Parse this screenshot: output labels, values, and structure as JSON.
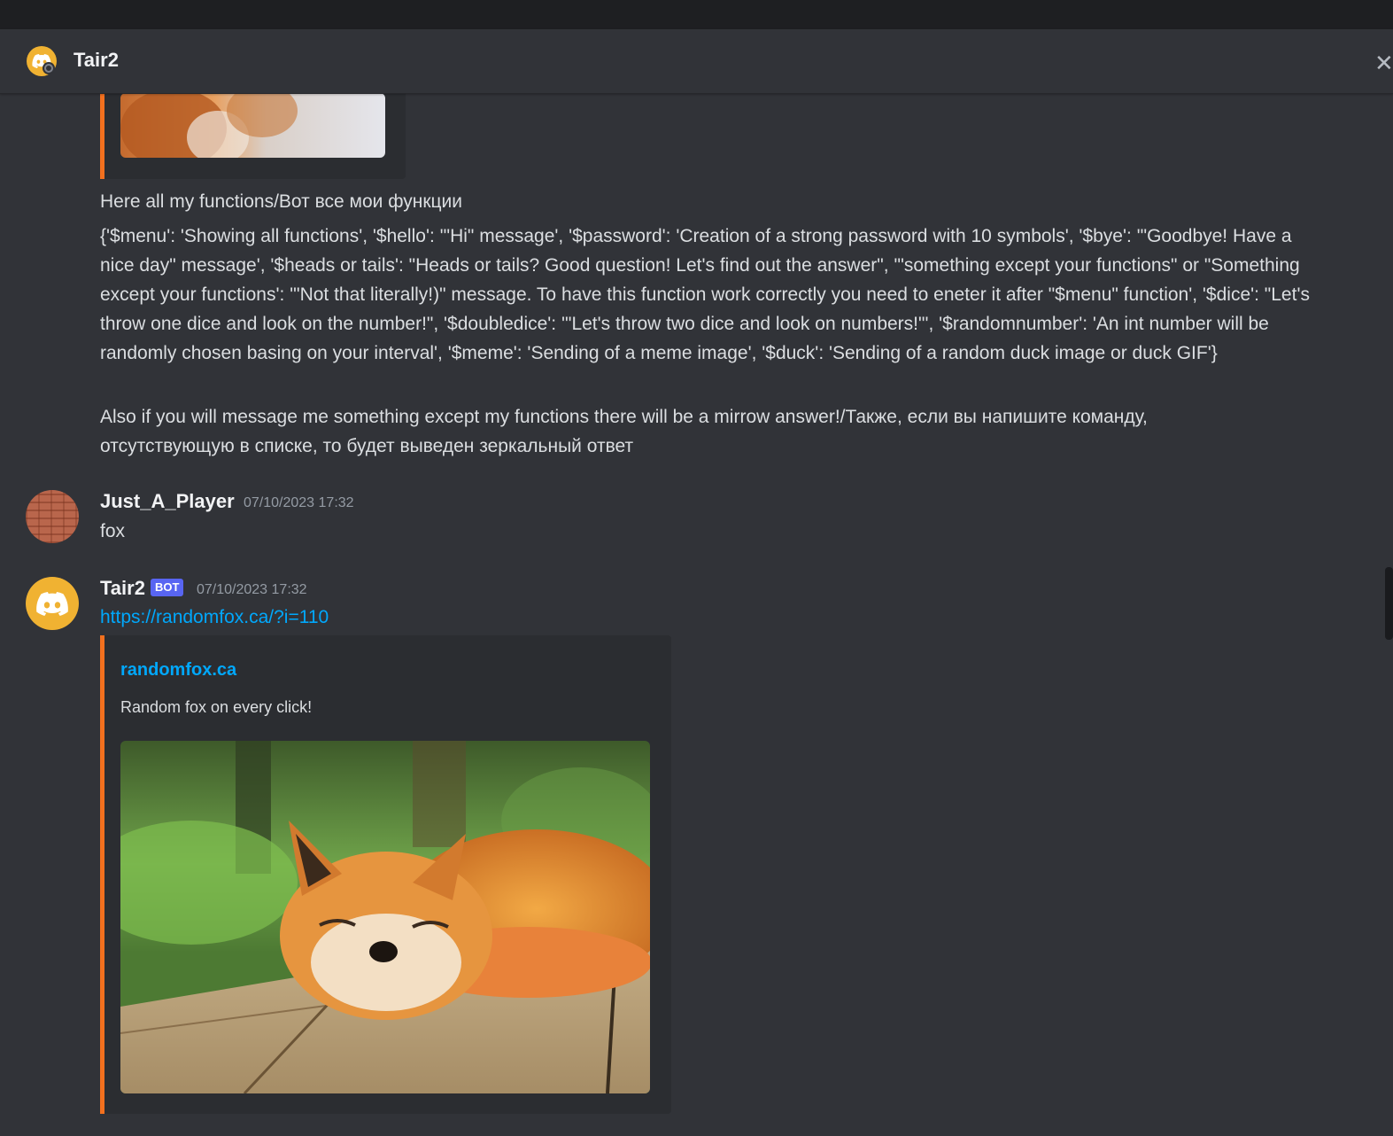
{
  "header": {
    "title": "Tair2",
    "avatar_icon": "discord-logo-icon",
    "close_icon": "close-icon"
  },
  "messages": {
    "functions_intro": "Here all my functions/Вот все мои функции",
    "functions_list": "{'$menu': 'Showing all functions', '$hello': '\"Hi\" message', '$password': 'Creation of a strong password with 10 symbols', '$bye': '\"Goodbye! Have a nice day\" message', '$heads or tails': \"Heads or tails? Good question! Let's find out the answer\", '\"something except your functions\" or \"Something except your functions': '\"Not that literally!)\" message. To have this function work correctly you need to eneter it after \"$menu\" function', '$dice': \"Let's throw one dice and look on the number!\", '$doubledice': '\"Let's throw two dice and look on numbers!\"', '$randomnumber': 'An int number will be randomly chosen basing on your interval', '$meme': 'Sending of a meme image', '$duck': 'Sending of a random duck image or duck GIF'}",
    "mirror_note": "Also if you will message me something except my functions there will be a mirrow answer!/Также, если вы напишите команду, отсутствующую в списке, то будет выведен зеркальный ответ"
  },
  "user_message": {
    "username": "Just_A_Player",
    "timestamp": "07/10/2023 17:32",
    "text": "fox"
  },
  "bot_message": {
    "username": "Tair2",
    "badge": "BOT",
    "timestamp": "07/10/2023 17:32",
    "link": "https://randomfox.ca/?i=110",
    "embed": {
      "provider": "randomfox.ca",
      "description": "Random fox on every click!"
    }
  },
  "colors": {
    "background": "#313338",
    "embed_bg": "#2b2d31",
    "embed_accent": "#f2701e",
    "link": "#00a8fc",
    "bot_badge": "#5865f2",
    "bot_avatar": "#f0b232"
  }
}
